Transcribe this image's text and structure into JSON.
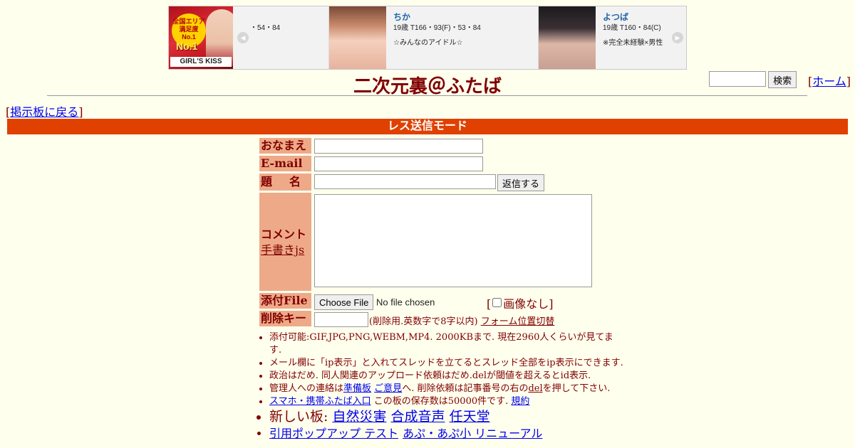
{
  "banner": {
    "logo_badge": "全国エリア 満足度 No.1",
    "logo_no1": "No.1",
    "logo_brand": "GIRL'S KISS",
    "partial_stats": "・54・84",
    "cards": [
      {
        "name": "ちか",
        "stats": "19歳 T166・93(F)・53・84",
        "catch": "☆みんなのアイドル☆"
      },
      {
        "name": "よつば",
        "stats": "19歳 T160・84(C)",
        "catch": "※完全未経験×男性"
      }
    ]
  },
  "header": {
    "title": "二次元裏＠ふたば",
    "search_placeholder": "",
    "search_button": "検索",
    "home_link": "ホーム",
    "back_link": "掲示板に戻る"
  },
  "mode_label": "レス送信モード",
  "form": {
    "name_label": "おなまえ",
    "email_label": "E-mail",
    "subject_label": "題　名",
    "reply_button": "返信する",
    "comment_label": "コメント",
    "handwrite_link": "手書きjs",
    "file_label": "添付File",
    "file_button": "Choose File",
    "file_status": "No file chosen",
    "no_image_label": "画像なし",
    "delkey_label": "削除キー",
    "delkey_note": "(削除用.英数字で8字以内)",
    "form_toggle_link": "フォーム位置切替"
  },
  "rules": {
    "r1": "添付可能:GIF,JPG,PNG,WEBM,MP4. 2000KBまで. 現在2960人くらいが見てます.",
    "r2": "メール欄に「ip表示」と入れてスレッドを立てるとスレッド全部をip表示にできます.",
    "r3": "政治はだめ. 同人関連のアップロード依頼はだめ.delが閾値を超えるとid表示.",
    "r4_pre": "管理人への連絡は",
    "r4_link1": "準備板",
    "r4_link2": "ご意見",
    "r4_mid": "へ. 削除依頼は記事番号の右の",
    "r4_link3": "del",
    "r4_post": "を押して下さい.",
    "r5_link": "スマホ・携帯ふたば入口",
    "r5_text": "この板の保存数は50000件です.",
    "r5_link2": "規約",
    "r6_label": "新しい板:",
    "r6_boards": [
      "自然災害",
      "合成音声",
      "任天堂"
    ],
    "r7_link1": "引用ポップアップ テスト",
    "r7_link2": "あぷ・あぷ小 リニューアル"
  }
}
